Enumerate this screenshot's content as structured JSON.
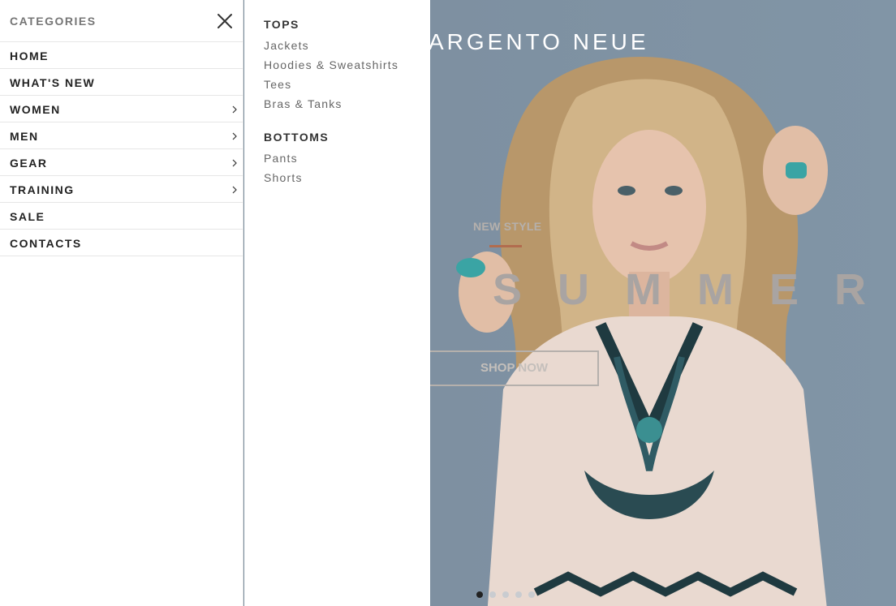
{
  "hero": {
    "logo": "ARGENTO NEUE",
    "subtitle": "NEW STYLE",
    "title": "SUMMER",
    "button_label": "SHOP NOW",
    "slides_total": 5,
    "active_slide": 1
  },
  "categories": {
    "title": "CATEGORIES",
    "items": [
      {
        "label": "HOME",
        "has_submenu": false
      },
      {
        "label": "WHAT'S NEW",
        "has_submenu": false
      },
      {
        "label": "WOMEN",
        "has_submenu": true
      },
      {
        "label": "MEN",
        "has_submenu": true
      },
      {
        "label": "GEAR",
        "has_submenu": true
      },
      {
        "label": "TRAINING",
        "has_submenu": true
      },
      {
        "label": "SALE",
        "has_submenu": false
      },
      {
        "label": "CONTACTS",
        "has_submenu": false
      }
    ]
  },
  "submenu": {
    "groups": [
      {
        "title": "TOPS",
        "links": [
          "Jackets",
          "Hoodies & Sweatshirts",
          "Tees",
          "Bras & Tanks"
        ]
      },
      {
        "title": "BOTTOMS",
        "links": [
          "Pants",
          "Shorts"
        ]
      }
    ]
  },
  "colors": {
    "accent": "#b26c4e",
    "hero_bg": "#7d8fa0",
    "text_dark": "#222222",
    "text_muted": "#757575"
  }
}
